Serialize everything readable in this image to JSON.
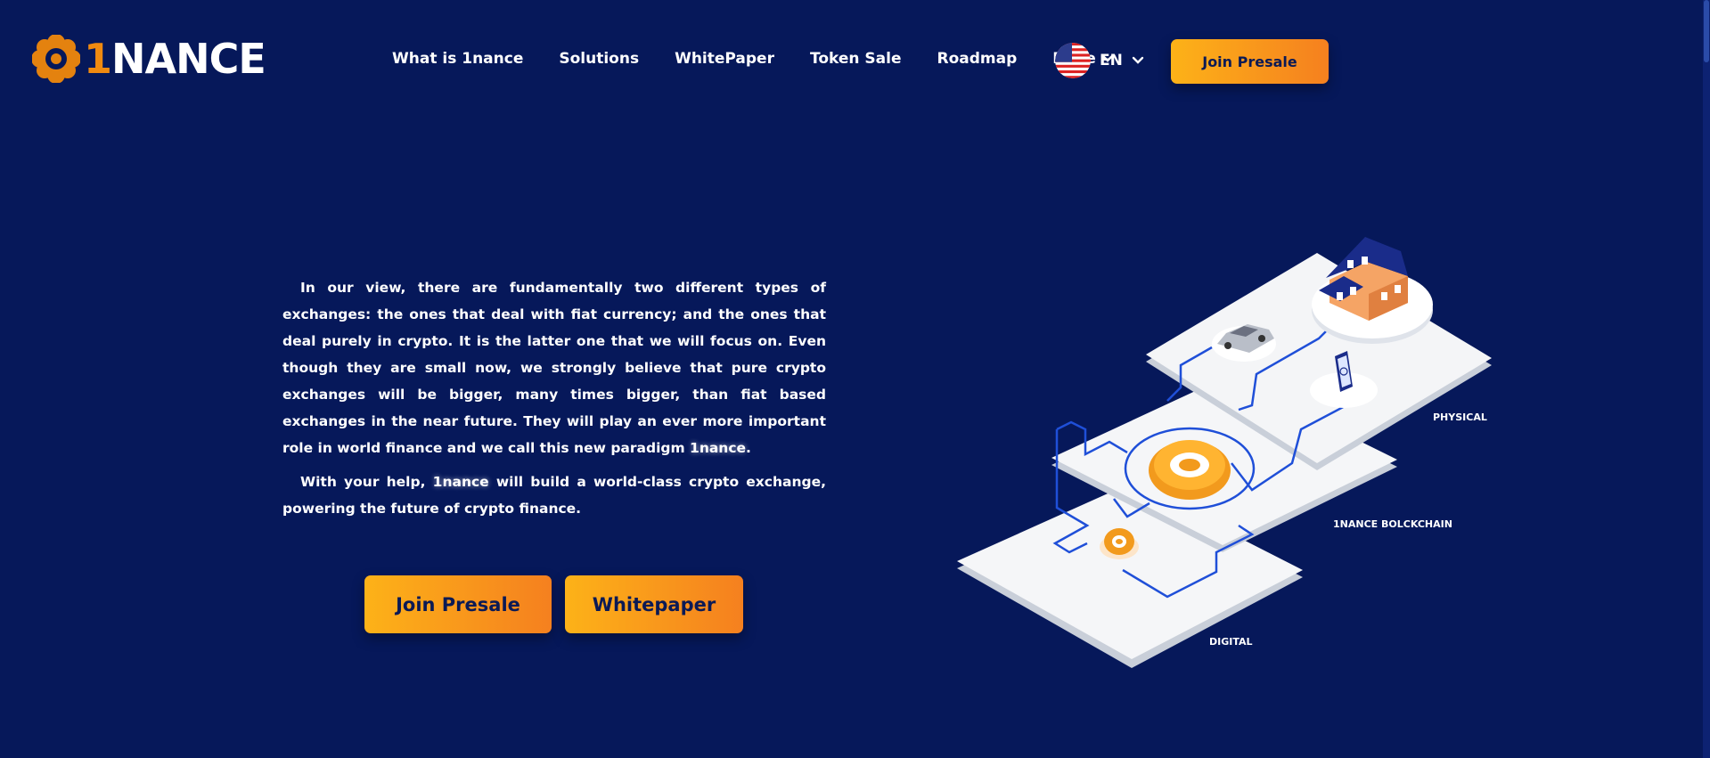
{
  "brand": {
    "digit": "1",
    "text": "NANCE"
  },
  "nav": {
    "items": [
      "What is 1nance",
      "Solutions",
      "WhitePaper",
      "Token Sale",
      "Roadmap"
    ],
    "more": "More"
  },
  "lang": {
    "code": "EN",
    "flag": "us-flag-icon"
  },
  "header": {
    "cta": "Join Presale"
  },
  "hero": {
    "p1_intro": "In our view, there are fundamentally two different types of exchanges: the ones that deal with fiat currency; and the ones that deal purely in crypto. It is the latter one that we will focus on. Even though they are small now, we strongly believe that pure crypto exchanges will be bigger, many times bigger, than fiat based exchanges in the near future. They will play an ever more important role in world finance and we call this new paradigm ",
    "p1_brand": "1nance",
    "p1_end": ".",
    "p2_intro": "With your help, ",
    "p2_brand": "1nance",
    "p2_rest": " will build a world-class crypto exchange, powering the future of crypto finance.",
    "join": "Join Presale",
    "whitepaper": "Whitepaper"
  },
  "illustration": {
    "layers": [
      "PHYSICAL",
      "1NANCE BOLCKCHAIN",
      "DIGITAL"
    ]
  },
  "colors": {
    "background": "#06185a",
    "accent_start": "#fdb218",
    "accent_end": "#f5801f",
    "circuit": "#1f4fd8"
  }
}
